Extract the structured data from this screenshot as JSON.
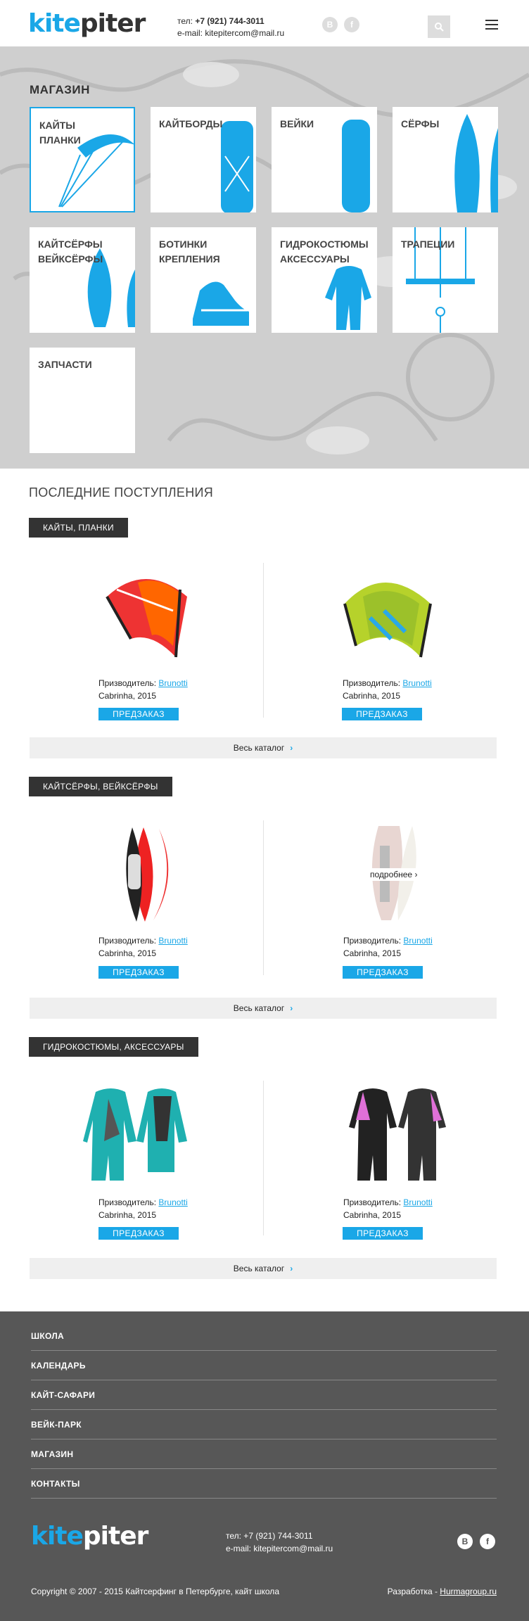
{
  "header": {
    "logo_kite": "kite",
    "logo_piter": "piter",
    "phone_prefix": "тел: ",
    "phone": "+7 (921) 744-3011",
    "email": "e-mail: kitepitercom@mail.ru",
    "vk_label": "В",
    "fb_label": "f",
    "search_icon": "search-icon",
    "menu_icon": "menu-icon"
  },
  "shop": {
    "title": "МАГАЗИН",
    "tiles": [
      {
        "label": "КАЙТЫ\nПЛАНКИ",
        "icon": "kite-icon"
      },
      {
        "label": "КАЙТБОРДЫ",
        "icon": "kiteboard-icon"
      },
      {
        "label": "ВЕЙКИ",
        "icon": "wakeboard-icon"
      },
      {
        "label": "СЁРФЫ",
        "icon": "surfboard-icon"
      },
      {
        "label": "КАЙТСЁРФЫ\nВЕЙКСЁРФЫ",
        "icon": "kitesurf-icon"
      },
      {
        "label": "БОТИНКИ\nКРЕПЛЕНИЯ",
        "icon": "boot-icon"
      },
      {
        "label": "ГИДРОКОСТЮМЫ\nАКСЕССУАРЫ",
        "icon": "wetsuit-icon"
      },
      {
        "label": "ТРАПЕЦИИ",
        "icon": "harness-bar-icon"
      },
      {
        "label": "ЗАПЧАСТИ",
        "icon": ""
      }
    ]
  },
  "latest": {
    "title": "ПОСЛЕДНИЕ ПОСТУПЛЕНИЯ",
    "catalog_link": "Весь каталог",
    "categories": [
      {
        "name": "КАЙТЫ, ПЛАНКИ",
        "products": [
          {
            "maker_label": "Призводитель: ",
            "maker": "Brunotti",
            "model": "Cabrinha, 2015",
            "button": "ПРЕДЗАКАЗ"
          },
          {
            "maker_label": "Призводитель: ",
            "maker": "Brunotti",
            "model": "Cabrinha, 2015",
            "button": "ПРЕДЗАКАЗ"
          }
        ]
      },
      {
        "name": "КАЙТСЁРФЫ, ВЕЙКСЁРФЫ",
        "products": [
          {
            "maker_label": "Призводитель: ",
            "maker": "Brunotti",
            "model": "Cabrinha, 2015",
            "button": "ПРЕДЗАКАЗ"
          },
          {
            "maker_label": "Призводитель: ",
            "maker": "Brunotti",
            "model": "Cabrinha, 2015",
            "button": "ПРЕДЗАКАЗ",
            "hover": "подробнее"
          }
        ]
      },
      {
        "name": "ГИДРОКОСТЮМЫ, АКСЕССУАРЫ",
        "products": [
          {
            "maker_label": "Призводитель: ",
            "maker": "Brunotti",
            "model": "Cabrinha, 2015",
            "button": "ПРЕДЗАКАЗ"
          },
          {
            "maker_label": "Призводитель: ",
            "maker": "Brunotti",
            "model": "Cabrinha, 2015",
            "button": "ПРЕДЗАКАЗ"
          }
        ]
      }
    ]
  },
  "footer": {
    "nav": [
      "ШКОЛА",
      "КАЛЕНДАРЬ",
      "КАЙТ-САФАРИ",
      "ВЕЙК-ПАРК",
      "МАГАЗИН",
      "КОНТАКТЫ"
    ],
    "logo_kite": "kite",
    "logo_piter": "piter",
    "phone": "тел: +7 (921) 744-3011",
    "email": "e-mail: kitepitercom@mail.ru",
    "vk_label": "В",
    "fb_label": "f",
    "copyright": "Copyright © 2007 - 2015 Кайтсерфинг в Петербурге, кайт школа",
    "dev_prefix": "Разработка - ",
    "dev_link": "Hurmagroup.ru"
  },
  "colors": {
    "accent": "#1aa7e7",
    "dark": "#333333",
    "footer": "#575757"
  }
}
